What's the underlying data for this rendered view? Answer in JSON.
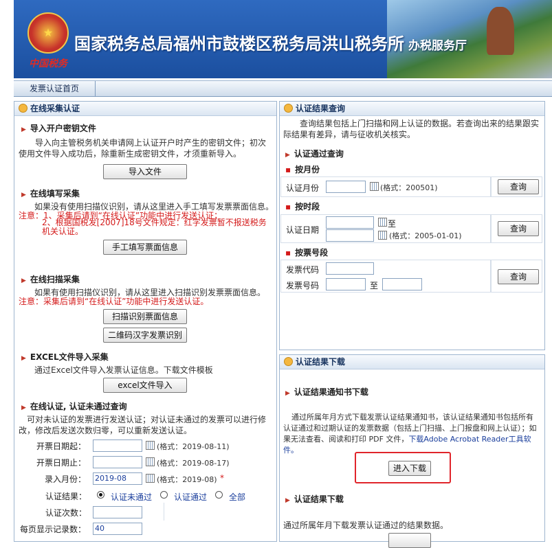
{
  "header": {
    "title": "国家税务总局福州市鼓楼区税务局洪山税务所",
    "subtitle": "办税服务厅",
    "logo_text": "中国税务"
  },
  "nav": {
    "tab_home": "发票认证首页"
  },
  "left": {
    "panel_title": "在线采集认证",
    "import_key": {
      "heading": "导入开户密钥文件",
      "desc": "导入向主管税务机关申请网上认证开户时产生的密钥文件；初次使用文件导入成功后，除重新生成密钥文件，才须重新导入。",
      "button": "导入文件"
    },
    "manual": {
      "heading": "在线填写采集",
      "desc": "如果没有使用扫描仪识别，请从这里进入手工填写发票票面信息。",
      "note1": "注意：1、采集后请到“在线认证”功能中进行发送认证；",
      "note2": "2、根据国税发[2007]18号文件规定：红字发票暂不报送税务机关认证。",
      "button": "手工填写票面信息"
    },
    "scan": {
      "heading": "在线扫描采集",
      "desc": "如果有使用扫描仪识别，请从这里进入扫描识别发票票面信息。",
      "note": "注意：采集后请到“在线认证”功能中进行发送认证。",
      "button1": "扫描识别票面信息",
      "button2": "二维码汉字发票识别"
    },
    "excel": {
      "heading": "EXCEL文件导入采集",
      "desc": "通过Excel文件导入发票认证信息。下载文件模板",
      "button": "excel文件导入"
    },
    "query": {
      "heading": "在线认证, 认证未通过查询",
      "desc": "可对未认证的发票进行发送认证；对认证未通过的发票可以进行修改，修改后发送次数归零，可以重新发送认证。",
      "start_label": "开票日期起：",
      "start_fmt": "(格式：2019-08-11)",
      "end_label": "开票日期止：",
      "end_fmt": "(格式：2019-08-17)",
      "month_label": "录入月份：",
      "month_value": "2019-08",
      "month_fmt": "(格式：2019-08)",
      "required_mark": "*",
      "result_label": "认证结果：",
      "opt1": "认证未通过",
      "opt2": "认证通过",
      "opt3": "全部",
      "count_label": "认证次数：",
      "perpage_label": "每页显示记录数：",
      "perpage_value": "40"
    }
  },
  "right_top": {
    "panel_title": "认证结果查询",
    "desc": "查询结果包括上门扫描和网上认证的数据。若查询出来的结果跟实际结果有差异，请与征收机关核实。",
    "pass_heading": "认证通过查询",
    "by_month": {
      "heading": "按月份",
      "label": "认证月份",
      "fmt": "(格式：200501)",
      "button": "查询"
    },
    "by_period": {
      "heading": "按时段",
      "label": "认证日期",
      "to": "至",
      "fmt": "(格式：2005-01-01)",
      "button": "查询"
    },
    "by_number": {
      "heading": "按票号段",
      "code_label": "发票代码",
      "number_label": "发票号码",
      "to": "至",
      "button": "查询"
    }
  },
  "right_bottom": {
    "panel_title": "认证结果下载",
    "notice_heading": "认证结果通知书下载",
    "notice_desc": "通过所属年月方式下载发票认证结果通知书，该认证结果通知书包括所有认证通过和过期认证的发票数据（包括上门扫描、上门报盘和网上认证）；如果无法查看、阅读和打印 PDF 文件，",
    "notice_link": "下载Adobe Acrobat Reader工具软件。",
    "download_button": "进入下载",
    "result_heading": "认证结果下载",
    "result_desc": "通过所属年月下载发票认证通过的结果数据。"
  }
}
